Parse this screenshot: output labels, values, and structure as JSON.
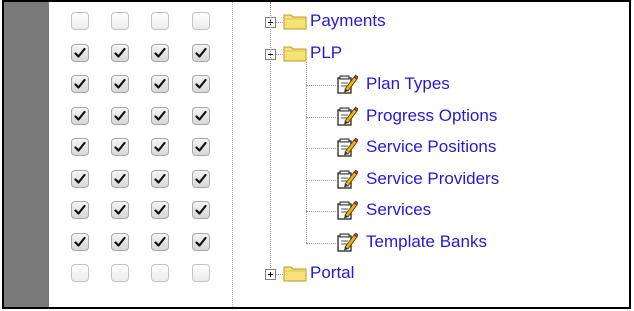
{
  "permissions": {
    "columns": 4,
    "rows": [
      {
        "checked": [
          false,
          false,
          false,
          false
        ]
      },
      {
        "checked": [
          true,
          true,
          true,
          true
        ]
      },
      {
        "checked": [
          true,
          true,
          true,
          true
        ]
      },
      {
        "checked": [
          true,
          true,
          true,
          true
        ]
      },
      {
        "checked": [
          true,
          true,
          true,
          true
        ]
      },
      {
        "checked": [
          true,
          true,
          true,
          true
        ]
      },
      {
        "checked": [
          true,
          true,
          true,
          true
        ]
      },
      {
        "checked": [
          true,
          true,
          true,
          true
        ]
      },
      {
        "checked": [
          false,
          false,
          false,
          false
        ]
      }
    ]
  },
  "tree": {
    "nodes": [
      {
        "label": "Payments",
        "kind": "folder",
        "expander": "collapsed",
        "depth": 0
      },
      {
        "label": "PLP",
        "kind": "folder",
        "expander": "expanded",
        "depth": 0
      },
      {
        "label": "Plan Types",
        "kind": "page",
        "depth": 1
      },
      {
        "label": "Progress Options",
        "kind": "page",
        "depth": 1
      },
      {
        "label": "Service Positions",
        "kind": "page",
        "depth": 1
      },
      {
        "label": "Service Providers",
        "kind": "page",
        "depth": 1
      },
      {
        "label": "Services",
        "kind": "page",
        "depth": 1
      },
      {
        "label": "Template Banks",
        "kind": "page",
        "depth": 1
      },
      {
        "label": "Portal",
        "kind": "folder",
        "expander": "collapsed",
        "depth": 0
      }
    ]
  },
  "colors": {
    "link": "#2419d6",
    "sidebar_gray": "#7a7a7a",
    "folder_yellow": "#f7e27a",
    "page_pencil": "#f0b400"
  }
}
